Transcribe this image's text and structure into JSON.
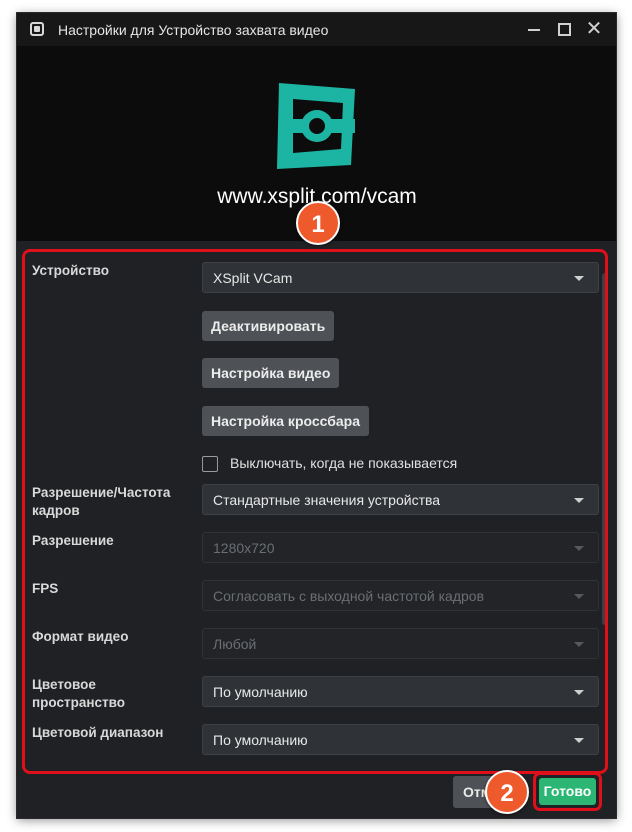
{
  "window": {
    "title": "Настройки для Устройство захвата видео",
    "controls": {
      "minimize": "—",
      "maximize": "☐",
      "close": "✕"
    }
  },
  "header": {
    "logo_icon": "xsplit-vcam-logo",
    "url": "www.xsplit.com/vcam",
    "logo_color": "#1cb5a3"
  },
  "form": {
    "device": {
      "label": "Устройство",
      "value": "XSplit VCam"
    },
    "buttons": {
      "deactivate": "Деактивировать",
      "video_settings": "Настройка видео",
      "crossbar_settings": "Настройка кроссбара"
    },
    "deactivate_when_hidden": {
      "label": "Выключать, когда не показывается",
      "checked": false
    },
    "resolution_fps_type": {
      "label": "Разрешение/Частота кадров",
      "value": "Стандартные значения устройства"
    },
    "resolution": {
      "label": "Разрешение",
      "value": "1280x720"
    },
    "fps": {
      "label": "FPS",
      "value": "Согласовать с выходной частотой кадров"
    },
    "video_format": {
      "label": "Формат видео",
      "value": "Любой"
    },
    "color_space": {
      "label": "Цветовое пространство",
      "value": "По умолчанию"
    },
    "color_range": {
      "label": "Цветовой диапазон",
      "value": "По умолчанию"
    }
  },
  "footer": {
    "cancel_label": "Отмена",
    "ok_label": "Готово"
  },
  "annotations": {
    "marker_1": "1",
    "marker_2": "2",
    "highlight_color": "#e0101a",
    "marker_color": "#ee5a2b"
  }
}
